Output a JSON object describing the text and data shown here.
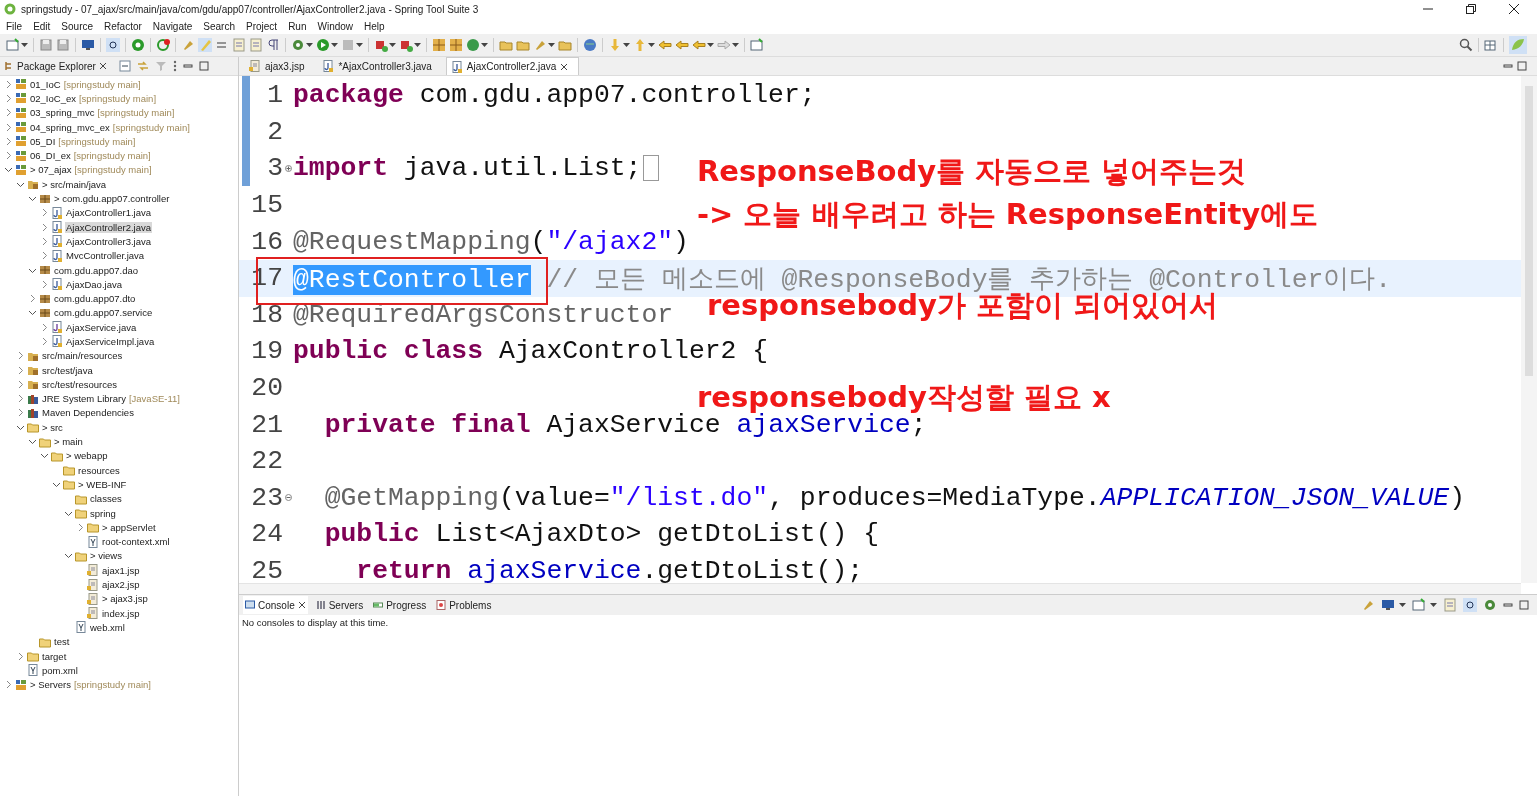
{
  "window": {
    "title": "springstudy - 07_ajax/src/main/java/com/gdu/app07/controller/AjaxController2.java - Spring Tool Suite 3"
  },
  "menu": [
    "File",
    "Edit",
    "Source",
    "Refactor",
    "Navigate",
    "Search",
    "Project",
    "Run",
    "Window",
    "Help"
  ],
  "explorer": {
    "title": "Package Explorer",
    "tree": [
      {
        "label": "01_IoC",
        "decoration": "[springstudy main]",
        "kind": "project",
        "expanded": false,
        "selected": false
      },
      {
        "label": "02_IoC_ex",
        "decoration": "[springstudy main]",
        "kind": "project",
        "expanded": false,
        "selected": false
      },
      {
        "label": "03_spring_mvc",
        "decoration": "[springstudy main]",
        "kind": "project",
        "expanded": false,
        "selected": false
      },
      {
        "label": "04_spring_mvc_ex",
        "decoration": "[springstudy main]",
        "kind": "project",
        "expanded": false,
        "selected": false
      },
      {
        "label": "05_DI",
        "decoration": "[springstudy main]",
        "kind": "project",
        "expanded": false,
        "selected": false
      },
      {
        "label": "06_DI_ex",
        "decoration": "[springstudy main]",
        "kind": "project",
        "expanded": false,
        "selected": false
      },
      {
        "label": "> 07_ajax",
        "decoration": "[springstudy main]",
        "kind": "project",
        "expanded": true,
        "selected": false,
        "children": [
          {
            "label": "> src/main/java",
            "kind": "srcfolder",
            "expanded": true,
            "selected": false,
            "children": [
              {
                "label": "> com.gdu.app07.controller",
                "kind": "package",
                "expanded": true,
                "selected": false,
                "children": [
                  {
                    "label": "AjaxController1.java",
                    "kind": "java",
                    "expanded": false,
                    "selected": false
                  },
                  {
                    "label": "AjaxController2.java",
                    "kind": "java",
                    "expanded": false,
                    "selected": true
                  },
                  {
                    "label": "AjaxController3.java",
                    "kind": "java",
                    "expanded": false,
                    "selected": false
                  },
                  {
                    "label": "MvcController.java",
                    "kind": "java",
                    "expanded": false,
                    "selected": false
                  }
                ]
              },
              {
                "label": "com.gdu.app07.dao",
                "kind": "package",
                "expanded": true,
                "selected": false,
                "children": [
                  {
                    "label": "AjaxDao.java",
                    "kind": "java",
                    "expanded": false,
                    "selected": false
                  }
                ]
              },
              {
                "label": "com.gdu.app07.dto",
                "kind": "package",
                "expanded": false,
                "selected": false
              },
              {
                "label": "com.gdu.app07.service",
                "kind": "package",
                "expanded": true,
                "selected": false,
                "children": [
                  {
                    "label": "AjaxService.java",
                    "kind": "interface",
                    "expanded": false,
                    "selected": false
                  },
                  {
                    "label": "AjaxServiceImpl.java",
                    "kind": "java",
                    "expanded": false,
                    "selected": false
                  }
                ]
              }
            ]
          },
          {
            "label": "src/main/resources",
            "kind": "srcfolder",
            "expanded": false,
            "selected": false
          },
          {
            "label": "src/test/java",
            "kind": "srcfolder",
            "expanded": false,
            "selected": false
          },
          {
            "label": "src/test/resources",
            "kind": "srcfolder",
            "expanded": false,
            "selected": false
          },
          {
            "label": "JRE System Library",
            "decoration": "[JavaSE-11]",
            "kind": "library",
            "expanded": false,
            "selected": false
          },
          {
            "label": "Maven Dependencies",
            "kind": "library",
            "expanded": false,
            "selected": false
          },
          {
            "label": "> src",
            "kind": "folder",
            "expanded": true,
            "selected": false,
            "children": [
              {
                "label": "> main",
                "kind": "folder",
                "expanded": true,
                "selected": false,
                "children": [
                  {
                    "label": "> webapp",
                    "kind": "folder",
                    "expanded": true,
                    "selected": false,
                    "children": [
                      {
                        "label": "resources",
                        "kind": "folder",
                        "selected": false
                      },
                      {
                        "label": "> WEB-INF",
                        "kind": "folder",
                        "expanded": true,
                        "selected": false,
                        "children": [
                          {
                            "label": "classes",
                            "kind": "folder",
                            "selected": false
                          },
                          {
                            "label": "spring",
                            "kind": "folder",
                            "expanded": true,
                            "selected": false,
                            "children": [
                              {
                                "label": "> appServlet",
                                "kind": "folder",
                                "expanded": false,
                                "selected": false
                              },
                              {
                                "label": "root-context.xml",
                                "kind": "xml",
                                "selected": false
                              }
                            ]
                          },
                          {
                            "label": "> views",
                            "kind": "folder",
                            "expanded": true,
                            "selected": false,
                            "children": [
                              {
                                "label": "ajax1.jsp",
                                "kind": "jsp",
                                "selected": false
                              },
                              {
                                "label": "ajax2.jsp",
                                "kind": "jsp",
                                "selected": false
                              },
                              {
                                "label": "> ajax3.jsp",
                                "kind": "jsp",
                                "selected": false
                              },
                              {
                                "label": "index.jsp",
                                "kind": "jsp",
                                "selected": false
                              }
                            ]
                          },
                          {
                            "label": "web.xml",
                            "kind": "xml",
                            "selected": false
                          }
                        ]
                      }
                    ]
                  }
                ]
              },
              {
                "label": "test",
                "kind": "folder",
                "selected": false
              }
            ]
          },
          {
            "label": "target",
            "kind": "folder",
            "expanded": false,
            "selected": false
          },
          {
            "label": "pom.xml",
            "kind": "xml",
            "selected": false
          }
        ]
      },
      {
        "label": "> Servers",
        "decoration": "[springstudy main]",
        "kind": "project",
        "expanded": false,
        "selected": false
      }
    ]
  },
  "editor": {
    "tabs": [
      {
        "label": "ajax3.jsp",
        "kind": "jsp",
        "selected": false
      },
      {
        "label": "*AjaxController3.java",
        "kind": "java",
        "selected": false
      },
      {
        "label": "AjaxController2.java",
        "kind": "java",
        "selected": true
      }
    ],
    "lines": [
      {
        "number": "1",
        "current": false,
        "segments": [
          {
            "text": "package",
            "kind": "keyword"
          },
          {
            "text": " com.gdu.app07.controller;",
            "kind": "plain"
          }
        ]
      },
      {
        "number": "2",
        "current": false
      },
      {
        "number": "3",
        "current": false,
        "collapsed": true,
        "segments": [
          {
            "text": "import",
            "kind": "keyword"
          },
          {
            "text": " java.util.List;",
            "kind": "plain"
          }
        ]
      },
      {
        "number": "15",
        "current": false
      },
      {
        "number": "16",
        "current": false,
        "segments": [
          {
            "text": "@RequestMapping",
            "kind": "annotation"
          },
          {
            "text": "(",
            "kind": "plain"
          },
          {
            "text": "\"/ajax2\"",
            "kind": "string"
          },
          {
            "text": ")",
            "kind": "plain"
          }
        ]
      },
      {
        "number": "17",
        "current": true,
        "segments": [
          {
            "text": "@RestController",
            "kind": "selection"
          },
          {
            "text": " // 모든 메소드에 @ResponseBody를 추가하는 @Controller이다.",
            "kind": "comment"
          }
        ]
      },
      {
        "number": "18",
        "current": false,
        "segments": [
          {
            "text": "@RequiredArgsConstructor",
            "kind": "annotation"
          }
        ]
      },
      {
        "number": "19",
        "current": false,
        "segments": [
          {
            "text": "public class",
            "kind": "keyword"
          },
          {
            "text": " AjaxController2 {",
            "kind": "plain"
          }
        ]
      },
      {
        "number": "20",
        "current": false
      },
      {
        "number": "21",
        "current": false,
        "kind": "member",
        "segments": [
          {
            "text": "private final",
            "kind": "keyword"
          },
          {
            "text": " AjaxService ",
            "kind": "plain"
          },
          {
            "text": "ajaxService",
            "kind": "field"
          },
          {
            "text": ";",
            "kind": "plain"
          }
        ]
      },
      {
        "number": "22",
        "current": false
      },
      {
        "number": "23",
        "current": false,
        "collapsed": false,
        "kind": "member",
        "segments": [
          {
            "text": "@GetMapping",
            "kind": "annotation"
          },
          {
            "text": "(value=",
            "kind": "plain"
          },
          {
            "text": "\"/list.do\"",
            "kind": "string"
          },
          {
            "text": ", produces=MediaType.",
            "kind": "plain"
          },
          {
            "text": "APPLICATION_JSON_VALUE",
            "kind": "constant"
          },
          {
            "text": ")",
            "kind": "plain"
          }
        ]
      },
      {
        "number": "24",
        "current": false,
        "kind": "member",
        "segments": [
          {
            "text": "public",
            "kind": "keyword"
          },
          {
            "text": " List<AjaxDto> getDtoList() {",
            "kind": "plain"
          }
        ]
      },
      {
        "number": "25",
        "current": false,
        "kind": "body",
        "segments": [
          {
            "text": "return",
            "kind": "keyword"
          },
          {
            "text": " ajaxService",
            "kind": "field"
          },
          {
            "text": ".getDtoList();",
            "kind": "plain"
          }
        ]
      }
    ],
    "notes": [
      "ResponseBody를 자동으로 넣어주는것",
      "-> 오늘 배우려고 하는 ResponseEntity에도",
      "responsebody가 포함이 되어있어서",
      "responsebody작성할 필요 x"
    ]
  },
  "console": {
    "tabs": [
      {
        "label": "Console",
        "kind": "console",
        "selected": true
      },
      {
        "label": "Servers",
        "kind": "servers",
        "selected": false
      },
      {
        "label": "Progress",
        "kind": "progress",
        "selected": false
      },
      {
        "label": "Problems",
        "kind": "problems",
        "selected": false
      }
    ],
    "message": "No consoles to display at this time."
  }
}
